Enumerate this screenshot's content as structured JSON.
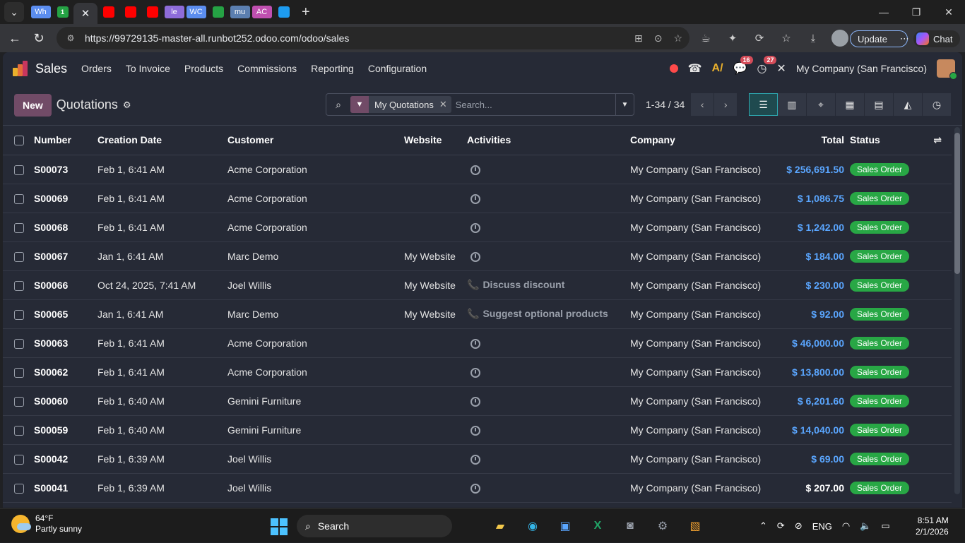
{
  "browser": {
    "tabs": [
      {
        "label": "Wh",
        "color": "#5b8def"
      },
      {
        "label": "1",
        "color": "#25a244"
      },
      {
        "label": "",
        "color": "#ff0000"
      },
      {
        "label": "",
        "color": "#ff0000"
      },
      {
        "label": "",
        "color": "#ff0000"
      },
      {
        "label": "le",
        "color": "#8e6cd9"
      },
      {
        "label": "WC",
        "color": "#5b8def"
      },
      {
        "label": "",
        "color": "#25a244"
      },
      {
        "label": "mu",
        "color": "#5b7fb0"
      },
      {
        "label": "AC",
        "color": "#c04fb0"
      },
      {
        "label": "",
        "color": "#1d9bf0"
      }
    ],
    "url": "https://99729135-master-all.runbot252.odoo.com/odoo/sales",
    "update_label": "Update",
    "chat_label": "Chat"
  },
  "odoo": {
    "app_name": "Sales",
    "menu": [
      "Orders",
      "To Invoice",
      "Products",
      "Commissions",
      "Reporting",
      "Configuration"
    ],
    "messages_badge": "16",
    "activities_badge": "27",
    "company": "My Company (San Francisco)",
    "new_label": "New",
    "page_title": "Quotations",
    "facet_label": "My Quotations",
    "search_placeholder": "Search...",
    "pager": "1-34 / 34",
    "columns": [
      "Number",
      "Creation Date",
      "Customer",
      "Website",
      "Activities",
      "Company",
      "Total",
      "Status"
    ],
    "rows": [
      {
        "number": "S00073",
        "date": "Feb 1, 6:41 AM",
        "customer": "Acme Corporation",
        "website": "",
        "activity": "",
        "company": "My Company (San Francisco)",
        "total": "$ 256,691.50",
        "status": "Sales Order"
      },
      {
        "number": "S00069",
        "date": "Feb 1, 6:41 AM",
        "customer": "Acme Corporation",
        "website": "",
        "activity": "",
        "company": "My Company (San Francisco)",
        "total": "$ 1,086.75",
        "status": "Sales Order"
      },
      {
        "number": "S00068",
        "date": "Feb 1, 6:41 AM",
        "customer": "Acme Corporation",
        "website": "",
        "activity": "",
        "company": "My Company (San Francisco)",
        "total": "$ 1,242.00",
        "status": "Sales Order"
      },
      {
        "number": "S00067",
        "date": "Jan 1, 6:41 AM",
        "customer": "Marc Demo",
        "website": "My Website",
        "activity": "",
        "company": "My Company (San Francisco)",
        "total": "$ 184.00",
        "status": "Sales Order"
      },
      {
        "number": "S00066",
        "date": "Oct 24, 2025, 7:41 AM",
        "customer": "Joel Willis",
        "website": "My Website",
        "activity": "Discuss discount",
        "company": "My Company (San Francisco)",
        "total": "$ 230.00",
        "status": "Sales Order"
      },
      {
        "number": "S00065",
        "date": "Jan 1, 6:41 AM",
        "customer": "Marc Demo",
        "website": "My Website",
        "activity": "Suggest optional products",
        "company": "My Company (San Francisco)",
        "total": "$ 92.00",
        "status": "Sales Order"
      },
      {
        "number": "S00063",
        "date": "Feb 1, 6:41 AM",
        "customer": "Acme Corporation",
        "website": "",
        "activity": "",
        "company": "My Company (San Francisco)",
        "total": "$ 46,000.00",
        "status": "Sales Order"
      },
      {
        "number": "S00062",
        "date": "Feb 1, 6:41 AM",
        "customer": "Acme Corporation",
        "website": "",
        "activity": "",
        "company": "My Company (San Francisco)",
        "total": "$ 13,800.00",
        "status": "Sales Order"
      },
      {
        "number": "S00060",
        "date": "Feb 1, 6:40 AM",
        "customer": "Gemini Furniture",
        "website": "",
        "activity": "",
        "company": "My Company (San Francisco)",
        "total": "$ 6,201.60",
        "status": "Sales Order"
      },
      {
        "number": "S00059",
        "date": "Feb 1, 6:40 AM",
        "customer": "Gemini Furniture",
        "website": "",
        "activity": "",
        "company": "My Company (San Francisco)",
        "total": "$ 14,040.00",
        "status": "Sales Order"
      },
      {
        "number": "S00042",
        "date": "Feb 1, 6:39 AM",
        "customer": "Joel Willis",
        "website": "",
        "activity": "",
        "company": "My Company (San Francisco)",
        "total": "$ 69.00",
        "status": "Sales Order"
      },
      {
        "number": "S00041",
        "date": "Feb 1, 6:39 AM",
        "customer": "Joel Willis",
        "website": "",
        "activity": "",
        "company": "My Company (San Francisco)",
        "total": "$ 207.00",
        "status": "Sales Order"
      }
    ],
    "colors": {
      "accent": "#714b67",
      "total_link": "#5aa6ff",
      "status_green": "#28a745"
    }
  },
  "taskbar": {
    "temperature": "64°F",
    "weather": "Partly sunny",
    "search_label": "Search",
    "language": "ENG",
    "time": "8:51 AM",
    "date": "2/1/2026"
  }
}
